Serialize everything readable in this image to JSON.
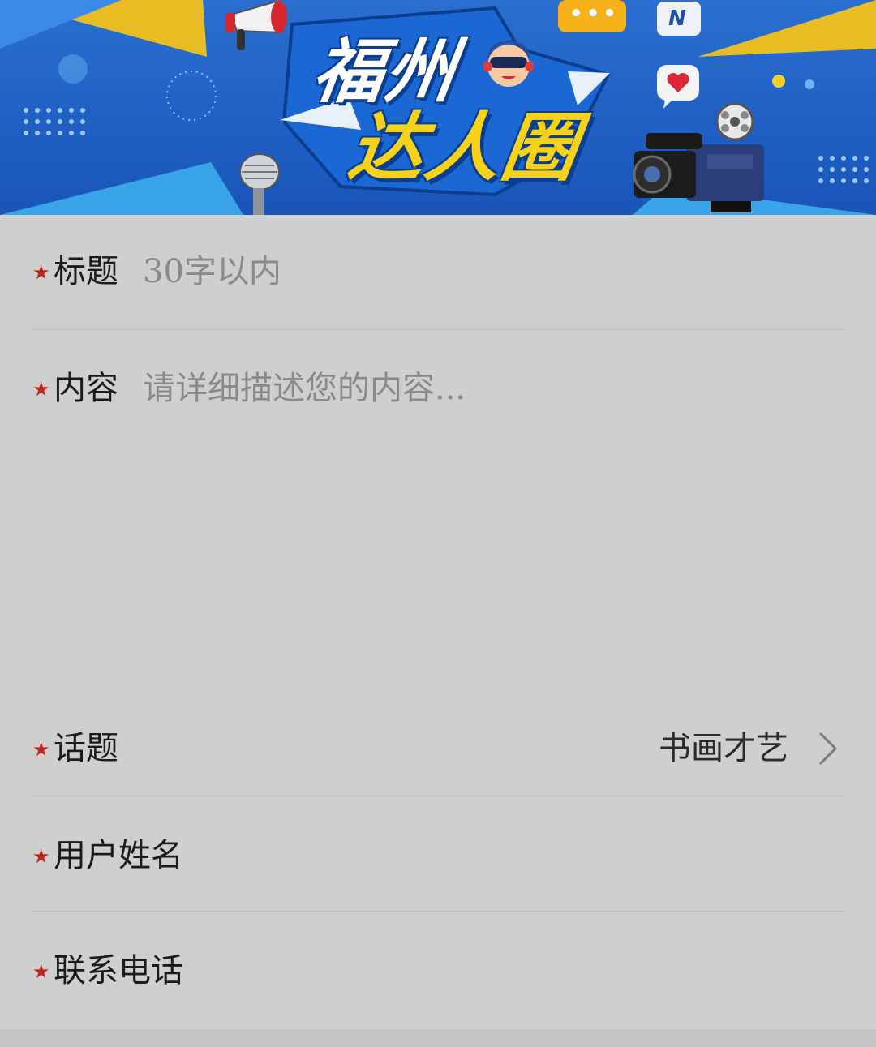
{
  "banner": {
    "title_line1": "福州",
    "title_line2": "达人圈",
    "chat_icon_text": "•••",
    "news_icon_text": "N"
  },
  "form": {
    "title": {
      "label": "标题",
      "placeholder": "30字以内"
    },
    "content": {
      "label": "内容",
      "placeholder": "请详细描述您的内容..."
    },
    "topic": {
      "label": "话题",
      "value": "书画才艺"
    },
    "username": {
      "label": "用户姓名"
    },
    "phone": {
      "label": "联系电话"
    }
  },
  "required_mark": "★",
  "colors": {
    "required_star": "#c0241c",
    "banner_blue": "#1f5fc4",
    "banner_yellow": "#f6d21a",
    "form_background": "#cfcfcf"
  },
  "icons": [
    "megaphone-icon",
    "chat-bubble-icon",
    "news-icon",
    "heart-bubble-icon",
    "microphone-icon",
    "video-camera-icon",
    "mascot-icon",
    "chevron-right-icon"
  ]
}
